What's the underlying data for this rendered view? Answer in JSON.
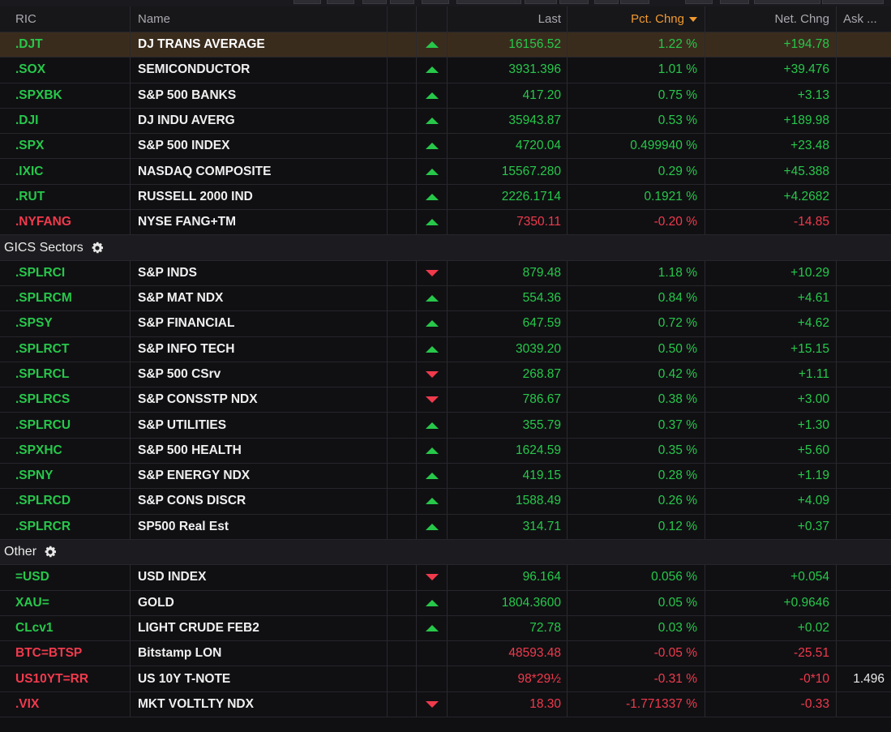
{
  "colors": {
    "up": "#27c84a",
    "down": "#f03a4c",
    "accent": "#f29a2e",
    "selected_row": "#3a2c1d"
  },
  "header": {
    "ric": "RIC",
    "name": "Name",
    "last": "Last",
    "pct": "Pct. Chng",
    "net": "Net. Chng",
    "ask": "Ask ..."
  },
  "rows": [
    {
      "ric": ".DJT",
      "name": "DJ TRANS AVERAGE",
      "dir": "up",
      "last": "16156.52",
      "pct": "1.22 %",
      "net": "+194.78",
      "ask": "",
      "ric_color": "up",
      "val_color": "up",
      "selected": true
    },
    {
      "ric": ".SOX",
      "name": "SEMICONDUCTOR",
      "dir": "up",
      "last": "3931.396",
      "pct": "1.01 %",
      "net": "+39.476",
      "ask": "",
      "ric_color": "up",
      "val_color": "up"
    },
    {
      "ric": ".SPXBK",
      "name": "S&P 500 BANKS",
      "dir": "up",
      "last": "417.20",
      "pct": "0.75 %",
      "net": "+3.13",
      "ask": "",
      "ric_color": "up",
      "val_color": "up"
    },
    {
      "ric": ".DJI",
      "name": "DJ INDU AVERG",
      "dir": "up",
      "last": "35943.87",
      "pct": "0.53 %",
      "net": "+189.98",
      "ask": "",
      "ric_color": "up",
      "val_color": "up"
    },
    {
      "ric": ".SPX",
      "name": "S&P 500 INDEX",
      "dir": "up",
      "last": "4720.04",
      "pct": "0.499940 %",
      "net": "+23.48",
      "ask": "",
      "ric_color": "up",
      "val_color": "up"
    },
    {
      "ric": ".IXIC",
      "name": "NASDAQ COMPOSITE",
      "dir": "up",
      "last": "15567.280",
      "pct": "0.29 %",
      "net": "+45.388",
      "ask": "",
      "ric_color": "up",
      "val_color": "up"
    },
    {
      "ric": ".RUT",
      "name": "RUSSELL 2000 IND",
      "dir": "up",
      "last": "2226.1714",
      "pct": "0.1921 %",
      "net": "+4.2682",
      "ask": "",
      "ric_color": "up",
      "val_color": "up"
    },
    {
      "ric": ".NYFANG",
      "name": "NYSE FANG+TM",
      "dir": "up",
      "last": "7350.11",
      "pct": "-0.20 %",
      "net": "-14.85",
      "ask": "",
      "ric_color": "dn",
      "val_color": "dn"
    },
    {
      "section": "GICS Sectors"
    },
    {
      "ric": ".SPLRCI",
      "name": "S&P INDS",
      "dir": "down",
      "last": "879.48",
      "pct": "1.18 %",
      "net": "+10.29",
      "ask": "",
      "ric_color": "up",
      "val_color": "up"
    },
    {
      "ric": ".SPLRCM",
      "name": "S&P MAT NDX",
      "dir": "up",
      "last": "554.36",
      "pct": "0.84 %",
      "net": "+4.61",
      "ask": "",
      "ric_color": "up",
      "val_color": "up"
    },
    {
      "ric": ".SPSY",
      "name": "S&P FINANCIAL",
      "dir": "up",
      "last": "647.59",
      "pct": "0.72 %",
      "net": "+4.62",
      "ask": "",
      "ric_color": "up",
      "val_color": "up"
    },
    {
      "ric": ".SPLRCT",
      "name": "S&P INFO TECH",
      "dir": "up",
      "last": "3039.20",
      "pct": "0.50 %",
      "net": "+15.15",
      "ask": "",
      "ric_color": "up",
      "val_color": "up"
    },
    {
      "ric": ".SPLRCL",
      "name": "S&P 500 CSrv",
      "dir": "down",
      "last": "268.87",
      "pct": "0.42 %",
      "net": "+1.11",
      "ask": "",
      "ric_color": "up",
      "val_color": "up"
    },
    {
      "ric": ".SPLRCS",
      "name": "S&P CONSSTP NDX",
      "dir": "down",
      "last": "786.67",
      "pct": "0.38 %",
      "net": "+3.00",
      "ask": "",
      "ric_color": "up",
      "val_color": "up"
    },
    {
      "ric": ".SPLRCU",
      "name": "S&P UTILITIES",
      "dir": "up",
      "last": "355.79",
      "pct": "0.37 %",
      "net": "+1.30",
      "ask": "",
      "ric_color": "up",
      "val_color": "up"
    },
    {
      "ric": ".SPXHC",
      "name": "S&P 500 HEALTH",
      "dir": "up",
      "last": "1624.59",
      "pct": "0.35 %",
      "net": "+5.60",
      "ask": "",
      "ric_color": "up",
      "val_color": "up"
    },
    {
      "ric": ".SPNY",
      "name": "S&P ENERGY NDX",
      "dir": "up",
      "last": "419.15",
      "pct": "0.28 %",
      "net": "+1.19",
      "ask": "",
      "ric_color": "up",
      "val_color": "up"
    },
    {
      "ric": ".SPLRCD",
      "name": "S&P CONS DISCR",
      "dir": "up",
      "last": "1588.49",
      "pct": "0.26 %",
      "net": "+4.09",
      "ask": "",
      "ric_color": "up",
      "val_color": "up"
    },
    {
      "ric": ".SPLRCR",
      "name": "SP500 Real Est",
      "dir": "up",
      "last": "314.71",
      "pct": "0.12 %",
      "net": "+0.37",
      "ask": "",
      "ric_color": "up",
      "val_color": "up"
    },
    {
      "section": "Other"
    },
    {
      "ric": "=USD",
      "name": "USD INDEX",
      "dir": "down",
      "last": "96.164",
      "pct": "0.056 %",
      "net": "+0.054",
      "ask": "",
      "ric_color": "up",
      "val_color": "up"
    },
    {
      "ric": "XAU=",
      "name": "GOLD",
      "dir": "up",
      "last": "1804.3600",
      "pct": "0.05 %",
      "net": "+0.9646",
      "ask": "",
      "ric_color": "up",
      "val_color": "up"
    },
    {
      "ric": "CLcv1",
      "name": "LIGHT CRUDE FEB2",
      "dir": "up",
      "last": "72.78",
      "pct": "0.03 %",
      "net": "+0.02",
      "ask": "",
      "ric_color": "up",
      "val_color": "up"
    },
    {
      "ric": "BTC=BTSP",
      "name": "Bitstamp LON",
      "dir": "",
      "last": "48593.48",
      "pct": "-0.05 %",
      "net": "-25.51",
      "ask": "",
      "ric_color": "dn",
      "val_color": "dn"
    },
    {
      "ric": "US10YT=RR",
      "name": "US 10Y T-NOTE",
      "dir": "",
      "last": "98*29½",
      "pct": "-0.31 %",
      "net": "-0*10",
      "ask": "1.496",
      "ric_color": "dn",
      "val_color": "dn"
    },
    {
      "ric": ".VIX",
      "name": "MKT VOLTLTY NDX",
      "dir": "down",
      "last": "18.30",
      "pct": "-1.771337 %",
      "net": "-0.33",
      "ask": "",
      "ric_color": "dn",
      "val_color": "dn"
    }
  ]
}
